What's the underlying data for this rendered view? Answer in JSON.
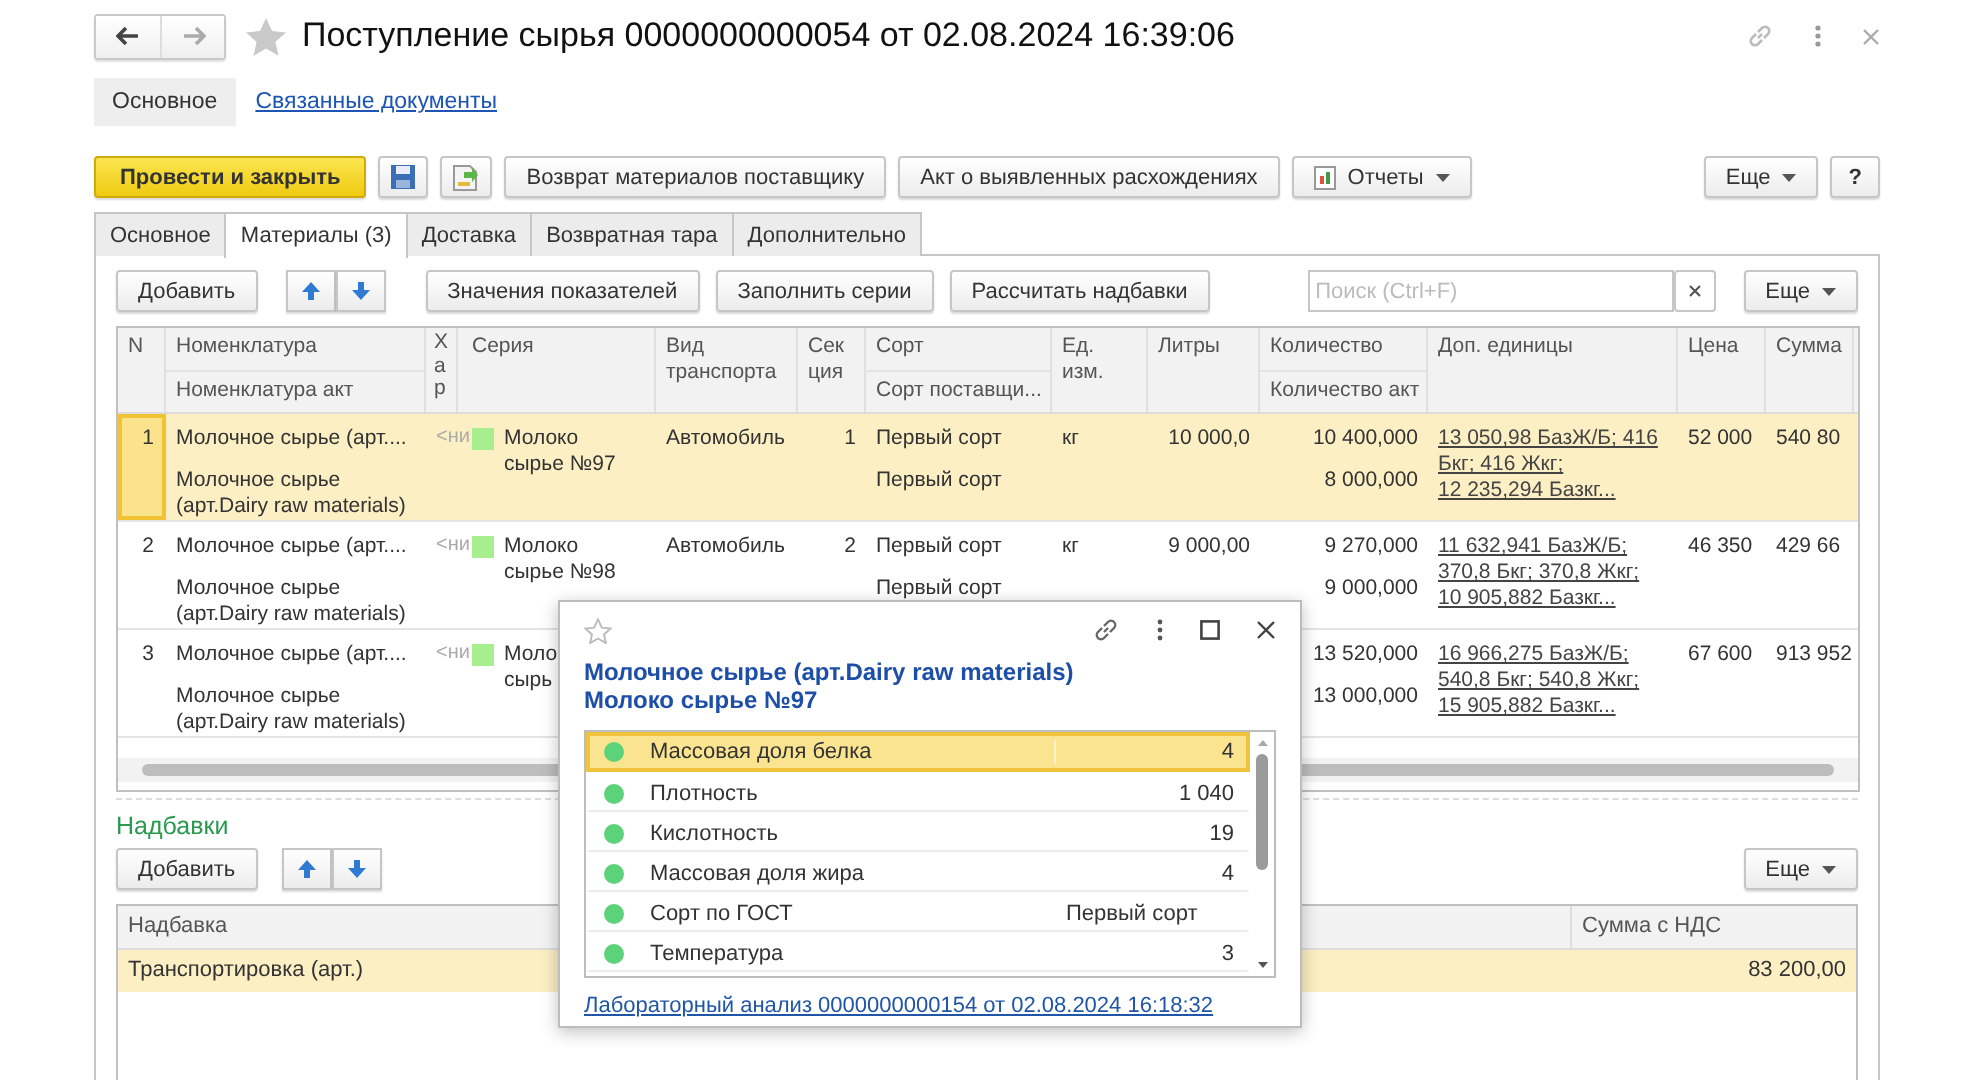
{
  "window": {
    "title": "Поступление сырья 0000000000054 от 02.08.2024 16:39:06"
  },
  "nav_tabs": [
    {
      "label": "Основное",
      "selected": true
    },
    {
      "label": "Связанные документы",
      "selected": false
    }
  ],
  "toolbar": {
    "primary": "Провести и закрыть",
    "buttons": [
      "Возврат материалов поставщику",
      "Акт о выявленных расхождениях"
    ],
    "reports": "Отчеты",
    "more": "Еще",
    "help": "?"
  },
  "tabs": [
    {
      "label": "Основное",
      "selected": false
    },
    {
      "label": "Материалы (3)",
      "selected": true
    },
    {
      "label": "Доставка",
      "selected": false
    },
    {
      "label": "Возвратная тара",
      "selected": false
    },
    {
      "label": "Дополнительно",
      "selected": false
    }
  ],
  "materials": {
    "add": "Добавить",
    "buttons": [
      "Значения показателей",
      "Заполнить серии",
      "Рассчитать надбавки"
    ],
    "search": {
      "placeholder": "Поиск (Ctrl+F)"
    },
    "more": "Еще",
    "columns": [
      {
        "label": "N"
      },
      {
        "label": "Номенклатура",
        "sublabel": "Номенклатура акт"
      },
      {
        "label": "Хар"
      },
      {
        "label": "Серия"
      },
      {
        "label": "Вид транспорта"
      },
      {
        "label": "Секция"
      },
      {
        "label": "Сорт",
        "sublabel": "Сорт поставщи..."
      },
      {
        "label": "Ед. изм."
      },
      {
        "label": "Литры"
      },
      {
        "label": "Количество",
        "sublabel": "Количество акт"
      },
      {
        "label": "Доп. единицы"
      },
      {
        "label": "Цена"
      },
      {
        "label": "Сумма"
      }
    ],
    "rows": [
      {
        "n": "1",
        "item": "Молочное сырье (арт....",
        "item_act": "Молочное сырье (арт.Dairy raw materials)",
        "char": "<ни",
        "series": [
          "Молоко",
          "сырье №97"
        ],
        "transport": "Автомобиль",
        "section": "1",
        "sort": "Первый сорт",
        "sort_supplier": "Первый сорт",
        "unit": "кг",
        "liters": "10 000,0",
        "qty": "10 400,000",
        "qty_act": "8 000,000",
        "units": [
          "13 050,98 БазЖ/Б; 416",
          "Бкг; 416 Жкг;",
          "12 235,294 Базкг..."
        ],
        "price": "52 000",
        "sum": "540 80",
        "selected": true
      },
      {
        "n": "2",
        "item": "Молочное сырье (арт....",
        "item_act": "Молочное сырье (арт.Dairy raw materials)",
        "char": "<ни",
        "series": [
          "Молоко",
          "сырье №98"
        ],
        "transport": "Автомобиль",
        "section": "2",
        "sort": "Первый сорт",
        "sort_supplier": "Первый сорт",
        "unit": "кг",
        "liters": "9 000,00",
        "qty": "9 270,000",
        "qty_act": "9 000,000",
        "units": [
          "11 632,941 БазЖ/Б;",
          "370,8 Бкг; 370,8 Жкг;",
          "10 905,882 Базкг..."
        ],
        "price": "46 350",
        "sum": "429 66",
        "selected": false
      },
      {
        "n": "3",
        "item": "Молочное сырье (арт....",
        "item_act": "Молочное сырье (арт.Dairy raw materials)",
        "char": "<ни",
        "series": [
          "Моло",
          "сырь"
        ],
        "qty": "13 520,000",
        "qty_act": "13 000,000",
        "units": [
          "16 966,275 БазЖ/Б;",
          "540,8 Бкг; 540,8 Жкг;",
          "15 905,882 Базкг..."
        ],
        "price": "67 600",
        "sum": "913 952",
        "selected": false
      }
    ]
  },
  "surcharges": {
    "title": "Надбавки",
    "add": "Добавить",
    "more": "Еще",
    "columns": [
      "Надбавка",
      "Сумма с НДС"
    ],
    "rows": [
      {
        "name": "Транспортировка (арт.)",
        "amount": "83 200,00",
        "selected": true
      }
    ]
  },
  "popup": {
    "title": "Молочное сырье (арт.Dairy raw materials)",
    "subtitle": "Молоко сырье №97",
    "indicators": [
      {
        "name": "Массовая доля белка",
        "value": "4",
        "kind": "number",
        "color": "#5cd27a",
        "selected": true
      },
      {
        "name": "Плотность",
        "value": "1 040",
        "kind": "number",
        "color": "#5cd27a",
        "selected": false
      },
      {
        "name": "Кислотность",
        "value": "19",
        "kind": "number",
        "color": "#5cd27a",
        "selected": false
      },
      {
        "name": "Массовая доля жира",
        "value": "4",
        "kind": "number",
        "color": "#5cd27a",
        "selected": false
      },
      {
        "name": "Сорт по ГОСТ",
        "value": "Первый сорт",
        "kind": "text",
        "color": "#5cd27a",
        "selected": false
      },
      {
        "name": "Температура",
        "value": "3",
        "kind": "number",
        "color": "#5cd27a",
        "selected": false
      }
    ],
    "link": "Лабораторный анализ 0000000000154 от 02.08.2024 16:18:32"
  }
}
